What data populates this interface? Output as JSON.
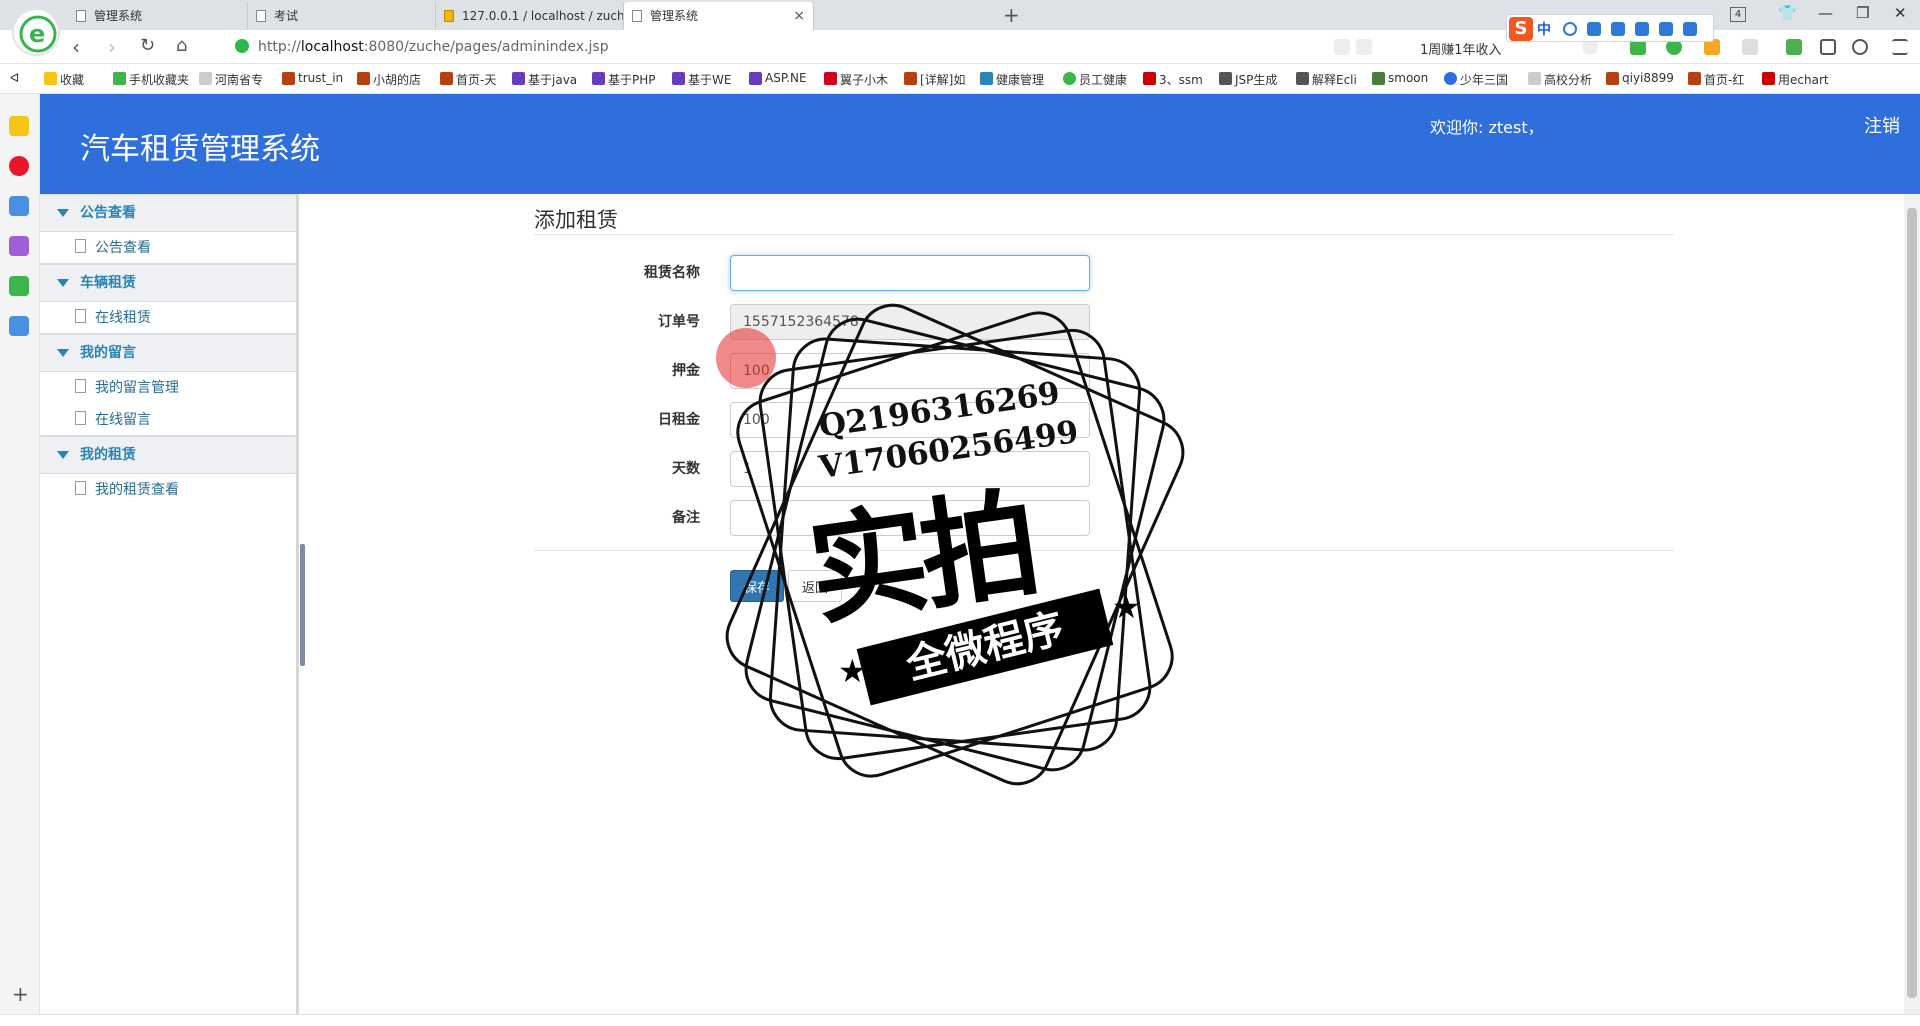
{
  "browser": {
    "tabs": [
      {
        "title": "管理系统",
        "active": false
      },
      {
        "title": "考试",
        "active": false
      },
      {
        "title": "127.0.0.1 / localhost / zuche /",
        "active": false
      },
      {
        "title": "管理系统",
        "active": true
      }
    ],
    "tab_close": "×",
    "new_tab": "+",
    "tab_count": "4",
    "ime_logo": "S",
    "ime_mode": "中",
    "url_prefix": "http://",
    "url_host": "localhost",
    "url_path": ":8080/zuche/pages/adminindex.jsp",
    "promo": "1周赚1年收入",
    "bookmarks_toggle": "ᐊ",
    "bookmarks": [
      "收藏",
      "手机收藏夹",
      "河南省专",
      "trust_in",
      "小胡的店",
      "首页-天",
      "基于java",
      "基于PHP",
      "基于WE",
      "ASP.NE",
      "翼子小木",
      "[详解]如",
      "健康管理",
      "员工健康",
      "3、ssm",
      "JSP生成",
      "解释Ecli",
      "smoon",
      "少年三国",
      "高校分析",
      "qiyi8899",
      "首页-红",
      "用echart"
    ],
    "strip_add": "+"
  },
  "header": {
    "site_title": "汽车租赁管理系统",
    "welcome": "欢迎你: ztest，",
    "logout": "注销"
  },
  "sidebar": {
    "groups": [
      {
        "title": "公告查看",
        "items": [
          "公告查看"
        ]
      },
      {
        "title": "车辆租赁",
        "items": [
          "在线租赁"
        ]
      },
      {
        "title": "我的留言",
        "items": [
          "我的留言管理",
          "在线留言"
        ]
      },
      {
        "title": "我的租赁",
        "items": [
          "我的租赁查看"
        ]
      }
    ]
  },
  "form": {
    "title": "添加租赁",
    "fields": [
      {
        "label": "租赁名称",
        "value": "",
        "readonly": false
      },
      {
        "label": "订单号",
        "value": "1557152364578",
        "readonly": true
      },
      {
        "label": "押金",
        "value": "100",
        "readonly": false
      },
      {
        "label": "日租金",
        "value": "100",
        "readonly": false
      },
      {
        "label": "天数",
        "value": "1",
        "readonly": false
      },
      {
        "label": "备注",
        "value": "",
        "readonly": false
      }
    ],
    "save": "保存",
    "back": "返回"
  },
  "watermark": {
    "line1": "Q2196316269",
    "line2": "V17060256499",
    "big": "实拍",
    "ribbon": "全微程序",
    "star": "★"
  },
  "colors": {
    "header_bg": "#2f6fdc",
    "sidebar_link": "#2a84b8",
    "primary_button": "#3276b1"
  }
}
